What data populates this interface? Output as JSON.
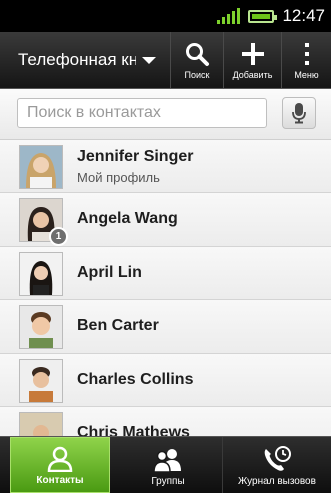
{
  "status_bar": {
    "time": "12:47",
    "icons": [
      "signal-icon",
      "battery-icon"
    ]
  },
  "action_bar": {
    "title": "Телефонная книга",
    "buttons": [
      {
        "icon": "search-icon",
        "label": "Поиск"
      },
      {
        "icon": "plus-icon",
        "label": "Добавить"
      },
      {
        "icon": "menu-icon",
        "label": "Меню"
      }
    ]
  },
  "search": {
    "placeholder": "Поиск в контактах",
    "value": "",
    "mic_icon": "microphone-icon"
  },
  "contacts": [
    {
      "name": "Jennifer Singer",
      "subtitle": "Мой профиль"
    },
    {
      "name": "Angela Wang",
      "badge": "1"
    },
    {
      "name": "April Lin"
    },
    {
      "name": "Ben Carter"
    },
    {
      "name": "Charles Collins"
    },
    {
      "name": "Chris Mathews"
    }
  ],
  "tabs": [
    {
      "label": "Контакты",
      "icon": "contact-person-icon",
      "active": true
    },
    {
      "label": "Группы",
      "icon": "group-icon",
      "active": false
    },
    {
      "label": "Журнал вызовов",
      "icon": "call-history-icon",
      "active": false
    }
  ],
  "colors": {
    "active_tab": "#6cb82a",
    "status_green": "#6cc418"
  }
}
